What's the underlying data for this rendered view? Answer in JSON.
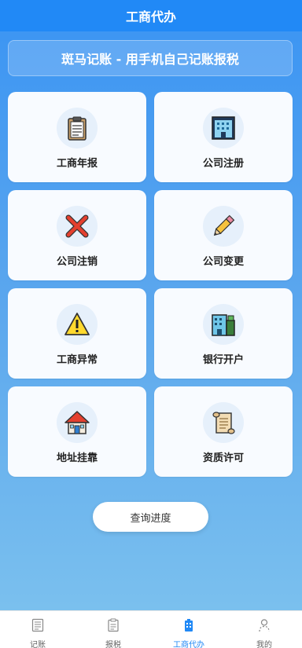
{
  "header": {
    "title": "工商代办"
  },
  "banner": {
    "text": "斑马记账 - 用手机自己记账报税"
  },
  "services": [
    {
      "label": "工商年报",
      "icon": "clipboard-icon"
    },
    {
      "label": "公司注册",
      "icon": "building-icon"
    },
    {
      "label": "公司注销",
      "icon": "cross-icon"
    },
    {
      "label": "公司变更",
      "icon": "pencil-icon"
    },
    {
      "label": "工商异常",
      "icon": "warning-icon"
    },
    {
      "label": "银行开户",
      "icon": "bank-building-icon"
    },
    {
      "label": "地址挂靠",
      "icon": "house-icon"
    },
    {
      "label": "资质许可",
      "icon": "scroll-icon"
    }
  ],
  "progress_button": {
    "label": "查询进度"
  },
  "tabbar": {
    "items": [
      {
        "label": "记账",
        "icon": "ledger-icon",
        "active": false
      },
      {
        "label": "报税",
        "icon": "tax-clipboard-icon",
        "active": false
      },
      {
        "label": "工商代办",
        "icon": "agency-icon",
        "active": true
      },
      {
        "label": "我的",
        "icon": "user-icon",
        "active": false
      }
    ]
  },
  "colors": {
    "primary": "#2189f6",
    "card_bg": "#f8fbff"
  }
}
